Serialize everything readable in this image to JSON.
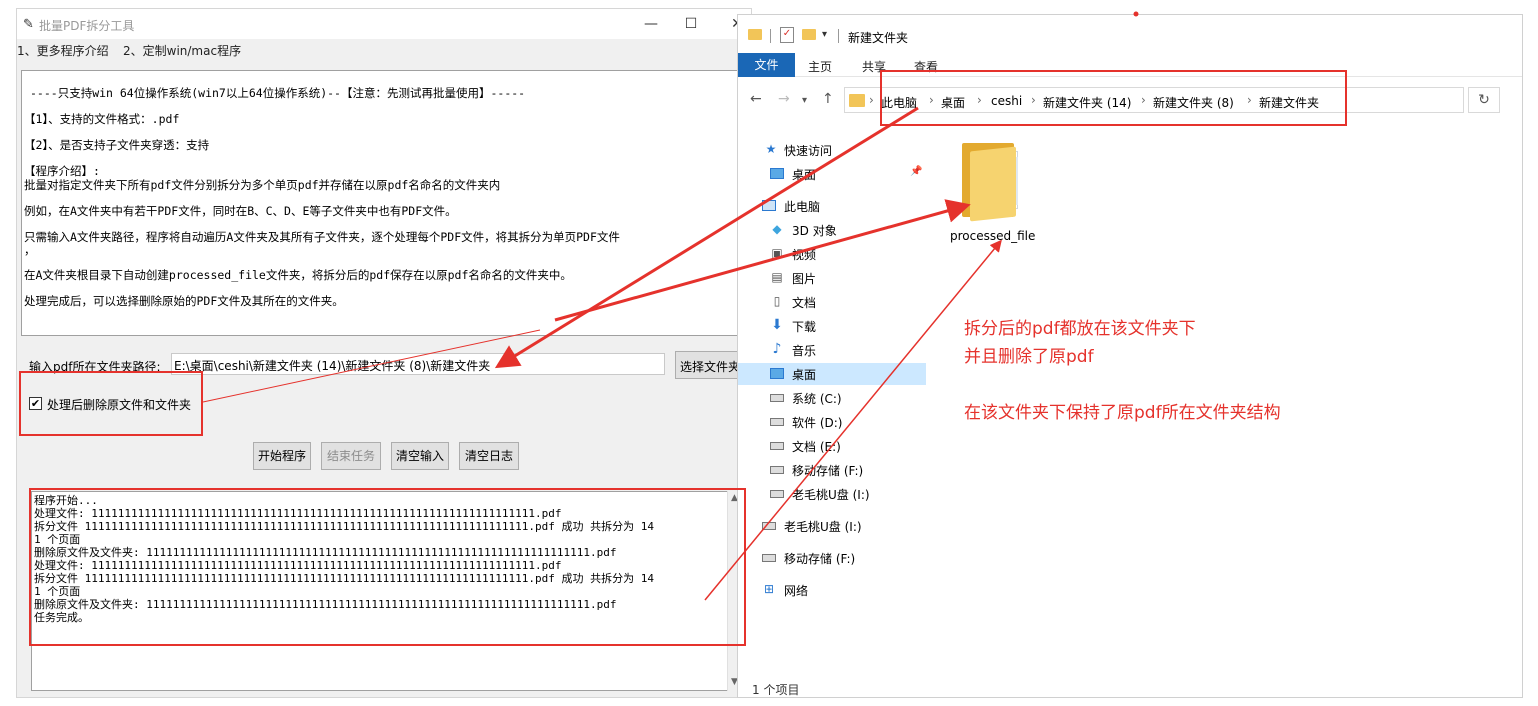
{
  "app": {
    "title": "批量PDF拆分工具",
    "minimize": "—",
    "maximize": "☐",
    "close": "✕",
    "menu": [
      "1、更多程序介绍",
      "2、定制win/mac程序"
    ],
    "info_lines": [
      "----只支持win 64位操作系统(win7以上64位操作系统)--【注意：先测试再批量使用】-----",
      "【1】、支持的文件格式：.pdf",
      "【2】、是否支持子文件夹穿透：支持",
      "【程序介绍】:",
      "批量对指定文件夹下所有pdf文件分别拆分为多个单页pdf并存储在以原pdf名命名的文件夹内",
      "例如，在A文件夹中有若干PDF文件，同时在B、C、D、E等子文件夹中也有PDF文件。",
      "只需输入A文件夹路径，程序将自动遍历A文件夹及其所有子文件夹，逐个处理每个PDF文件，将其拆分为单页PDF文件",
      "，",
      "在A文件夹根目录下自动创建processed_file文件夹，将拆分后的pdf保存在以原pdf名命名的文件夹中。",
      "处理完成后，可以选择删除原始的PDF文件及其所在的文件夹。"
    ],
    "path_label": "输入pdf所在文件夹路径:",
    "path_value": "E:\\桌面\\ceshi\\新建文件夹 (14)\\新建文件夹 (8)\\新建文件夹",
    "choose_button": "选择文件夹",
    "checkbox_mark": "✔",
    "checkbox_label": "处理后删除原文件和文件夹",
    "buttons": {
      "start": "开始程序",
      "end": "结束任务",
      "clear_input": "清空输入",
      "clear_log": "清空日志"
    },
    "log_lines": [
      "程序开始...",
      "处理文件: 1111111111111111111111111111111111111111111111111111111111111111111.pdf",
      "拆分文件 1111111111111111111111111111111111111111111111111111111111111111111.pdf 成功   共拆分为 14",
      "1 个页面",
      "删除原文件及文件夹: 1111111111111111111111111111111111111111111111111111111111111111111.pdf",
      "处理文件: 1111111111111111111111111111111111111111111111111111111111111111111.pdf",
      "拆分文件 1111111111111111111111111111111111111111111111111111111111111111111.pdf 成功   共拆分为 14",
      "1 个页面",
      "删除原文件及文件夹: 1111111111111111111111111111111111111111111111111111111111111111111.pdf",
      "任务完成。"
    ]
  },
  "explorer": {
    "title": "新建文件夹",
    "ribbon": {
      "file": "文件",
      "tabs": [
        "主页",
        "共享",
        "查看"
      ]
    },
    "breadcrumb": [
      "此电脑",
      "桌面",
      "ceshi",
      "新建文件夹 (14)",
      "新建文件夹 (8)",
      "新建文件夹"
    ],
    "nav_items": [
      {
        "label": "快速访问",
        "icon": "star-icon",
        "color": "#2b79d0"
      },
      {
        "label": "桌面",
        "icon": "desktop-icon",
        "color": "#2b79d0"
      },
      {
        "label": "此电脑",
        "icon": "computer-icon",
        "color": "#2b79d0"
      },
      {
        "label": "3D 对象",
        "icon": "cube-icon",
        "color": "#3ea5de"
      },
      {
        "label": "视频",
        "icon": "video-icon",
        "color": "#555555"
      },
      {
        "label": "图片",
        "icon": "picture-icon",
        "color": "#555555"
      },
      {
        "label": "文档",
        "icon": "document-icon",
        "color": "#555555"
      },
      {
        "label": "下载",
        "icon": "download-icon",
        "color": "#2b79d0"
      },
      {
        "label": "音乐",
        "icon": "music-icon",
        "color": "#2b79d0"
      },
      {
        "label": "桌面",
        "icon": "desktop-icon",
        "color": "#2b79d0"
      },
      {
        "label": "系统 (C:)",
        "icon": "drive-icon",
        "color": "#555555"
      },
      {
        "label": "软件 (D:)",
        "icon": "drive-icon",
        "color": "#555555"
      },
      {
        "label": "文档 (E:)",
        "icon": "drive-icon",
        "color": "#555555"
      },
      {
        "label": "移动存储 (F:)",
        "icon": "drive-icon",
        "color": "#555555"
      },
      {
        "label": "老毛桃U盘 (I:)",
        "icon": "drive-icon",
        "color": "#555555"
      },
      {
        "label": "老毛桃U盘 (I:)",
        "icon": "drive-icon",
        "color": "#555555"
      },
      {
        "label": "移动存储 (F:)",
        "icon": "drive-icon",
        "color": "#555555"
      },
      {
        "label": "网络",
        "icon": "network-icon",
        "color": "#2b79d0"
      }
    ],
    "folder_name": "processed_file",
    "status": "1 个项目"
  },
  "annotations": {
    "line1": "拆分后的pdf都放在该文件夹下",
    "line2": "并且删除了原pdf",
    "line3": "在该文件夹下保持了原pdf所在文件夹结构",
    "accent_color": "#e5322c"
  }
}
